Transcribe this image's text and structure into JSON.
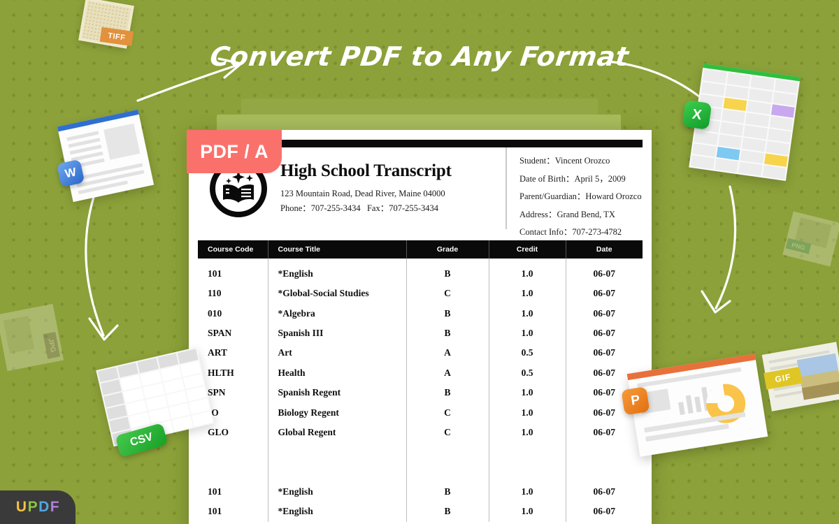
{
  "headline": "Convert PDF to Any Format",
  "badge": {
    "pdfa_label": "PDF / A"
  },
  "brand": {
    "u": "U",
    "p": "P",
    "d": "D",
    "f": "F"
  },
  "colors": {
    "background": "#8ca139",
    "badge_pink": "#fa716c",
    "word_blue": "#2f6fd0",
    "excel_green": "#2fbf3f",
    "ppt_orange": "#e8703a",
    "csv_green": "#17a027",
    "header_black": "#0a0a0a"
  },
  "document": {
    "school": {
      "title": "High School Transcript",
      "address": "123 Mountain Road, Dead River, Maine 04000",
      "contact": "Phone：707-255-3434   Fax：707-255-3434"
    },
    "student_info": [
      "Student：Vincent Orozco",
      "Date of Birth：April 5，2009",
      "Parent/Guardian：Howard Orozco",
      "Address：Grand Bend, TX",
      "Contact Info：707-273-4782"
    ],
    "table": {
      "columns": [
        "Course Code",
        "Course Title",
        "Grade",
        "Credit",
        "Date"
      ],
      "rows": [
        [
          "101",
          "*English",
          "B",
          "1.0",
          "06-07"
        ],
        [
          "110",
          "*Global-Social Studies",
          "C",
          "1.0",
          "06-07"
        ],
        [
          "010",
          "*Algebra",
          "B",
          "1.0",
          "06-07"
        ],
        [
          "SPAN",
          "Spanish III",
          "B",
          "1.0",
          "06-07"
        ],
        [
          "ART",
          "Art",
          "A",
          "0.5",
          "06-07"
        ],
        [
          "HLTH",
          "Health",
          "A",
          "0.5",
          "06-07"
        ],
        [
          "SPN",
          "Spanish Regent",
          "B",
          "1.0",
          "06-07"
        ],
        [
          "IO",
          "Biology Regent",
          "C",
          "1.0",
          "06-07"
        ],
        [
          "GLO",
          "Global Regent",
          "C",
          "1.0",
          "06-07"
        ],
        [
          "",
          "",
          "",
          "",
          ""
        ],
        [
          "",
          "",
          "",
          "",
          ""
        ],
        [
          "101",
          "*English",
          "B",
          "1.0",
          "06-07"
        ],
        [
          "101",
          "*English",
          "B",
          "1.0",
          "06-07"
        ]
      ]
    }
  },
  "format_cards": [
    {
      "id": "word",
      "tag": "W"
    },
    {
      "id": "excel",
      "tag": "X"
    },
    {
      "id": "ppt",
      "tag": "P"
    },
    {
      "id": "csv",
      "tag": "CSV"
    },
    {
      "id": "tiff",
      "tag": "TIFF"
    },
    {
      "id": "gif",
      "tag": "GIF"
    },
    {
      "id": "jpg",
      "tag": "JPG"
    },
    {
      "id": "png",
      "tag": "PNG"
    }
  ]
}
